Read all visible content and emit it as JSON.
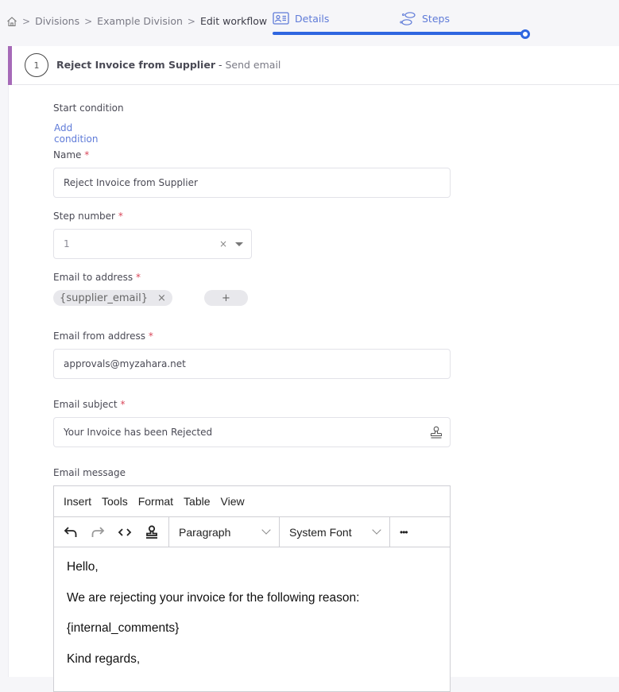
{
  "breadcrumb": {
    "home_icon": "home-icon",
    "items": [
      "Divisions",
      "Example Division"
    ],
    "current": "Edit workflow",
    "separator": ">"
  },
  "tabs": [
    {
      "label": "Details",
      "icon": "id-card-icon"
    },
    {
      "label": "Steps",
      "icon": "footsteps-icon"
    }
  ],
  "progress": {
    "percent": 100,
    "color": "#2f66e0"
  },
  "step": {
    "number": "1",
    "name": "Reject Invoice from Supplier",
    "dash": " - ",
    "type": "Send email",
    "accent_color": "#a66ab8"
  },
  "form": {
    "start_condition": {
      "label": "Start condition",
      "link": "Add condition"
    },
    "name": {
      "label": "Name",
      "required": "*",
      "value": "Reject Invoice from Supplier"
    },
    "step_number": {
      "label": "Step number",
      "required": "*",
      "value": "1",
      "clear": "×"
    },
    "email_to": {
      "label": "Email to address",
      "required": "*",
      "chips": [
        "{supplier_email}"
      ],
      "chip_remove": "×",
      "add": "+"
    },
    "email_from": {
      "label": "Email from address",
      "required": "*",
      "value": "approvals@myzahara.net"
    },
    "email_subject": {
      "label": "Email subject",
      "required": "*",
      "value": "Your Invoice has been Rejected"
    },
    "email_message": {
      "label": "Email message"
    }
  },
  "editor": {
    "menu": [
      "Insert",
      "Tools",
      "Format",
      "Table",
      "View"
    ],
    "block_format": "Paragraph",
    "font_family": "System Font",
    "more": "•••",
    "content": [
      "Hello,",
      "We are rejecting your invoice for the following reason:",
      "{internal_comments}",
      "Kind regards,"
    ]
  }
}
